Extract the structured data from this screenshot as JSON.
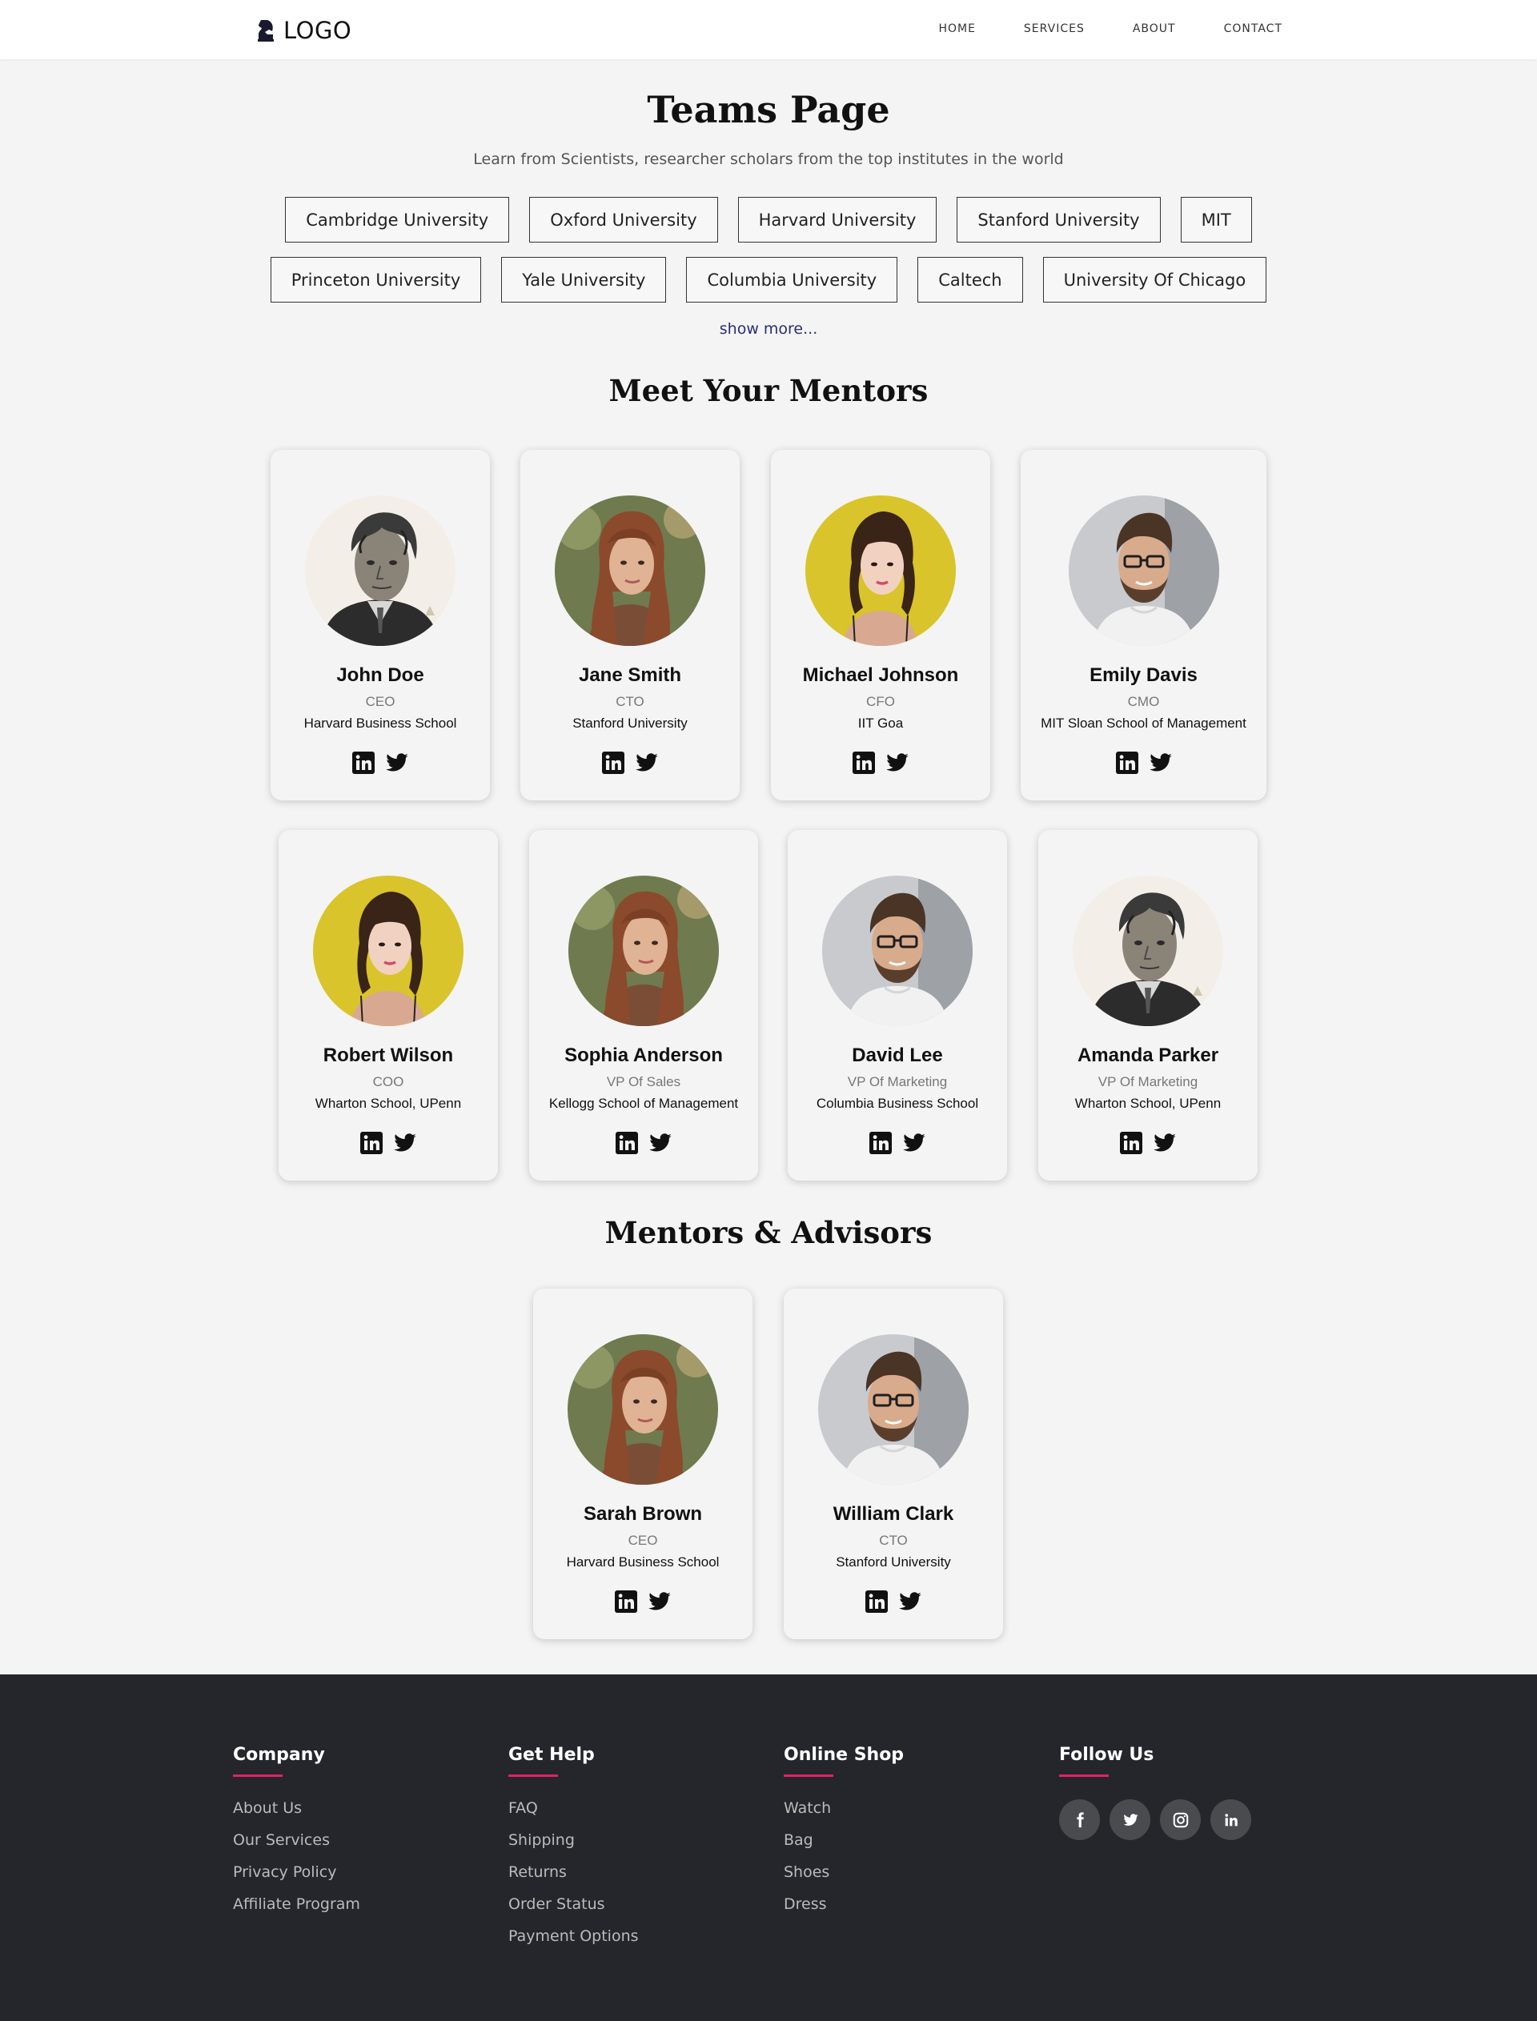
{
  "header": {
    "logo_text": "LOGO",
    "nav": [
      "HOME",
      "SERVICES",
      "ABOUT",
      "CONTACT"
    ]
  },
  "hero": {
    "title": "Teams Page",
    "subtitle": "Learn from Scientists, researcher scholars from the top institutes in the world",
    "universities_row1": [
      "Cambridge University",
      "Oxford University",
      "Harvard University",
      "Stanford University",
      "MIT"
    ],
    "universities_row2": [
      "Princeton University",
      "Yale University",
      "Columbia University",
      "Caltech",
      "University Of Chicago"
    ],
    "show_more": "show more..."
  },
  "mentors": {
    "title": "Meet Your Mentors",
    "items": [
      {
        "name": "John Doe",
        "role": "CEO",
        "school": "Harvard Business School",
        "photo": "old-man-bw"
      },
      {
        "name": "Jane Smith",
        "role": "CTO",
        "school": "Stanford University",
        "photo": "woman-auburn-hair"
      },
      {
        "name": "Michael Johnson",
        "role": "CFO",
        "school": "IIT Goa",
        "photo": "woman-yellow-bg"
      },
      {
        "name": "Emily Davis",
        "role": "CMO",
        "school": "MIT Sloan School of Management",
        "photo": "man-glasses"
      },
      {
        "name": "Robert Wilson",
        "role": "COO",
        "school": "Wharton School, UPenn",
        "photo": "woman-yellow-bg"
      },
      {
        "name": "Sophia Anderson",
        "role": "VP Of Sales",
        "school": "Kellogg School of Management",
        "photo": "woman-auburn-hair"
      },
      {
        "name": "David Lee",
        "role": "VP Of Marketing",
        "school": "Columbia Business School",
        "photo": "man-glasses"
      },
      {
        "name": "Amanda Parker",
        "role": "VP Of Marketing",
        "school": "Wharton School, UPenn",
        "photo": "old-man-bw"
      }
    ]
  },
  "advisors": {
    "title": "Mentors & Advisors",
    "items": [
      {
        "name": "Sarah Brown",
        "role": "CEO",
        "school": "Harvard Business School",
        "photo": "woman-auburn-hair"
      },
      {
        "name": "William Clark",
        "role": "CTO",
        "school": "Stanford University",
        "photo": "man-glasses"
      }
    ]
  },
  "footer": {
    "columns": [
      {
        "title": "Company",
        "links": [
          "About Us",
          "Our Services",
          "Privacy Policy",
          "Affiliate Program"
        ]
      },
      {
        "title": "Get Help",
        "links": [
          "FAQ",
          "Shipping",
          "Returns",
          "Order Status",
          "Payment Options"
        ]
      },
      {
        "title": "Online Shop",
        "links": [
          "Watch",
          "Bag",
          "Shoes",
          "Dress"
        ]
      }
    ],
    "follow_title": "Follow Us",
    "social_icons": [
      "facebook-icon",
      "twitter-icon",
      "instagram-icon",
      "linkedin-icon"
    ],
    "accent": "#e91e63"
  },
  "colors": {
    "page_bg": "#f4f4f4",
    "footer_bg": "#24262b",
    "show_more": "#2a2f75"
  }
}
